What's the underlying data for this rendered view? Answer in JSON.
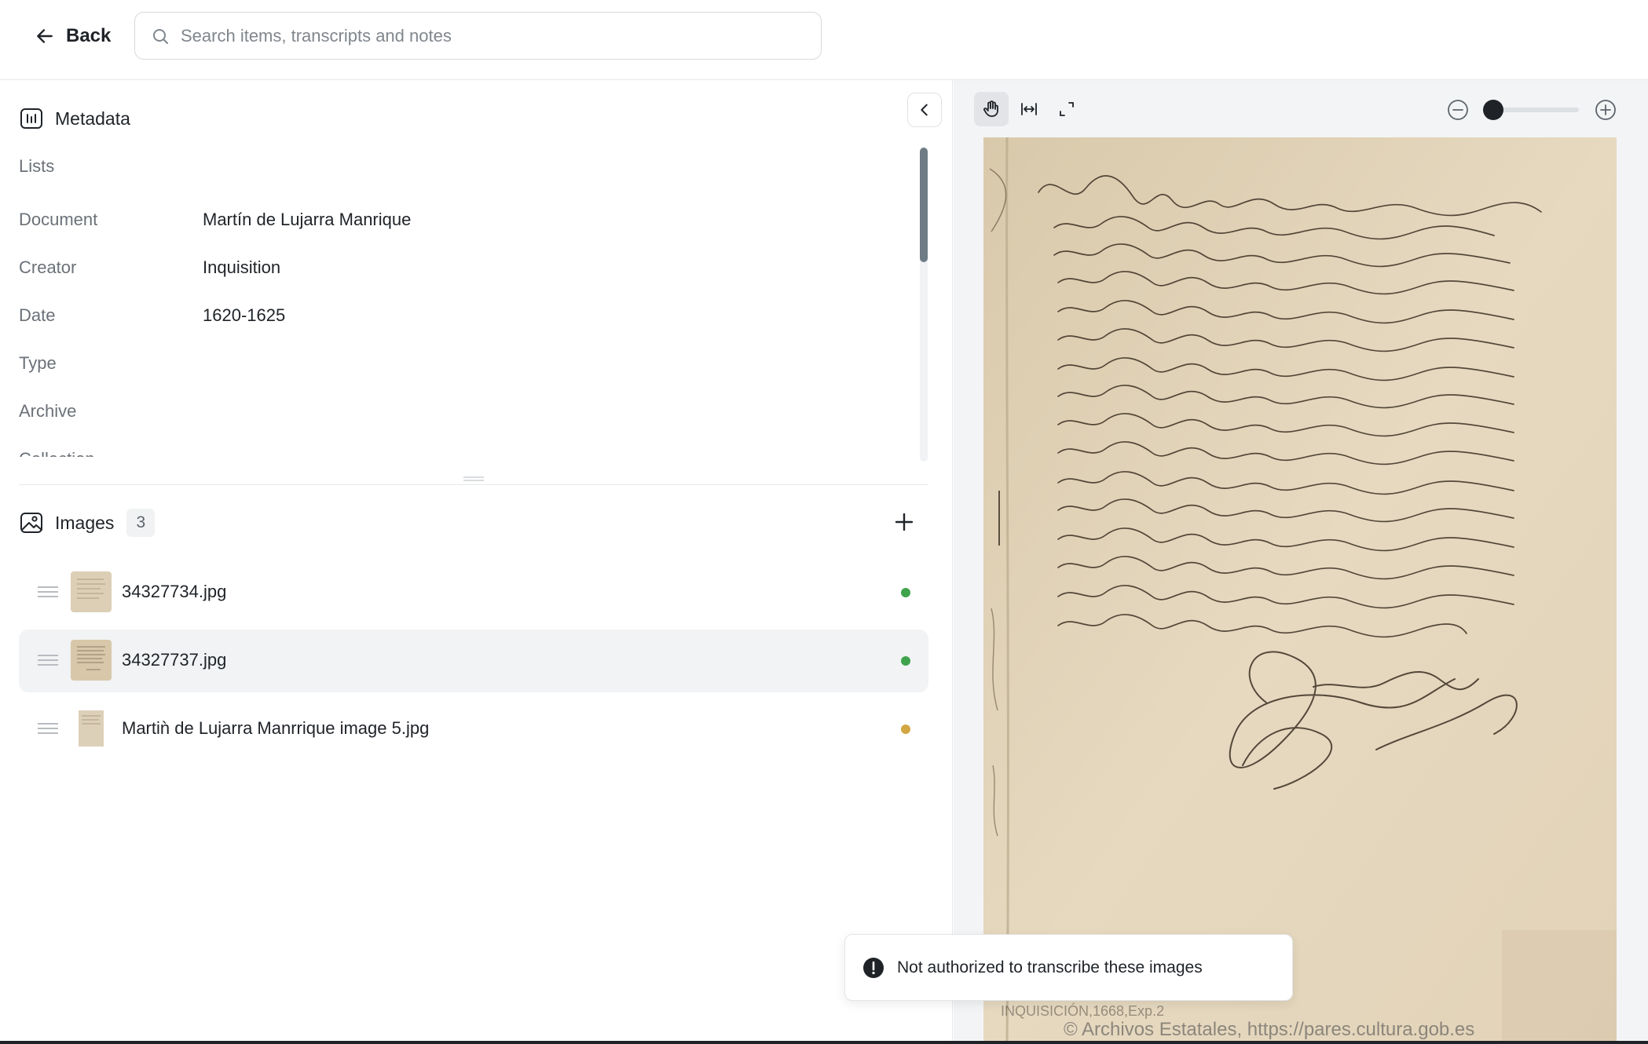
{
  "topbar": {
    "back_label": "Back",
    "search_placeholder": "Search items, transcripts and notes",
    "search_value": ""
  },
  "metadata": {
    "title": "Metadata",
    "rows": [
      {
        "key": "Lists",
        "value": ""
      },
      {
        "key": "Document",
        "value": "Martín de Lujarra Manrique"
      },
      {
        "key": "Creator",
        "value": "Inquisition"
      },
      {
        "key": "Date",
        "value": "1620-1625"
      },
      {
        "key": "Type",
        "value": ""
      },
      {
        "key": "Archive",
        "value": ""
      },
      {
        "key": "Collection",
        "value": ""
      }
    ]
  },
  "images": {
    "title": "Images",
    "count": "3",
    "items": [
      {
        "name": "34327734.jpg",
        "status_color": "#3fa34d",
        "selected": false
      },
      {
        "name": "34327737.jpg",
        "status_color": "#3fa34d",
        "selected": true
      },
      {
        "name": "Martiǹ de Lujarra Manrrique image 5.jpg",
        "status_color": "#d2a642",
        "selected": false
      }
    ]
  },
  "viewer": {
    "watermark": "INQUISICIÓN,1668,Exp.2",
    "copyright": "© Archivos Estatales, https://pares.cultura.gob.es"
  },
  "toast": {
    "message": "Not authorized to transcribe these images"
  },
  "colors": {
    "status_ok": "#3fa34d",
    "status_pending": "#d2a642",
    "scroll_thumb": "#6f7c86",
    "paper": "#e4d6bd",
    "ink": "#3a2e22"
  },
  "icons": {
    "back": "arrow-left-icon",
    "search": "search-icon",
    "metadata": "metadata-icon",
    "images": "image-icon",
    "add": "plus-icon",
    "drag": "drag-handle-icon",
    "collapse": "chevron-left-icon",
    "pan": "hand-icon",
    "fit_width": "fit-width-icon",
    "fullscreen": "fullscreen-icon",
    "zoom_out": "zoom-out-icon",
    "zoom_in": "zoom-in-icon",
    "alert": "alert-icon"
  }
}
